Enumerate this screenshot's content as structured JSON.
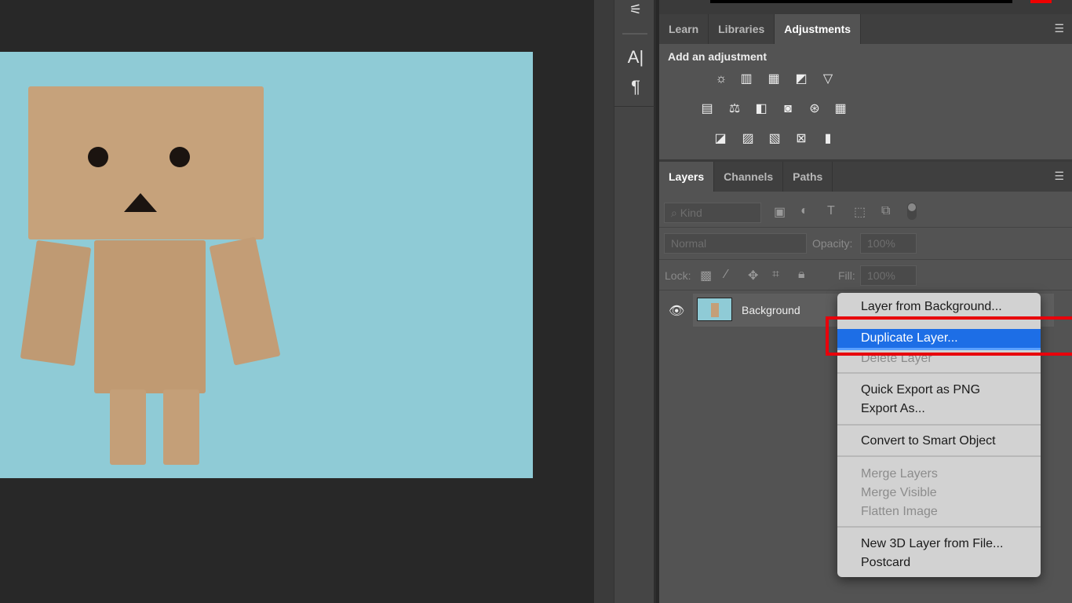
{
  "tools": {
    "type": "A|",
    "paragraph": "¶"
  },
  "top_panel": {
    "tabs": [
      "Learn",
      "Libraries",
      "Adjustments"
    ],
    "active_tab": "Adjustments",
    "heading": "Add an adjustment"
  },
  "layers_panel": {
    "tabs": [
      "Layers",
      "Channels",
      "Paths"
    ],
    "active_tab": "Layers",
    "filter_kind": "Kind",
    "blend_mode": "Normal",
    "opacity_label": "Opacity:",
    "opacity_value": "100%",
    "lock_label": "Lock:",
    "fill_label": "Fill:",
    "fill_value": "100%",
    "layer_name": "Background"
  },
  "context_menu": {
    "items": [
      {
        "label": "Layer from Background...",
        "state": "enabled"
      },
      {
        "label": "Duplicate Layer...",
        "state": "selected"
      },
      {
        "label": "Delete Layer",
        "state": "disabled"
      },
      {
        "label": "Quick Export as PNG",
        "state": "enabled"
      },
      {
        "label": "Export As...",
        "state": "enabled"
      },
      {
        "label": "Convert to Smart Object",
        "state": "enabled"
      },
      {
        "label": "Merge Layers",
        "state": "disabled"
      },
      {
        "label": "Merge Visible",
        "state": "disabled"
      },
      {
        "label": "Flatten Image",
        "state": "disabled"
      },
      {
        "label": "New 3D Layer from File...",
        "state": "enabled"
      },
      {
        "label": "Postcard",
        "state": "enabled"
      }
    ]
  },
  "colors": {
    "highlight": "#e8000b",
    "selection": "#1d6ee6",
    "canvas_bg": "#8fcbd6"
  }
}
